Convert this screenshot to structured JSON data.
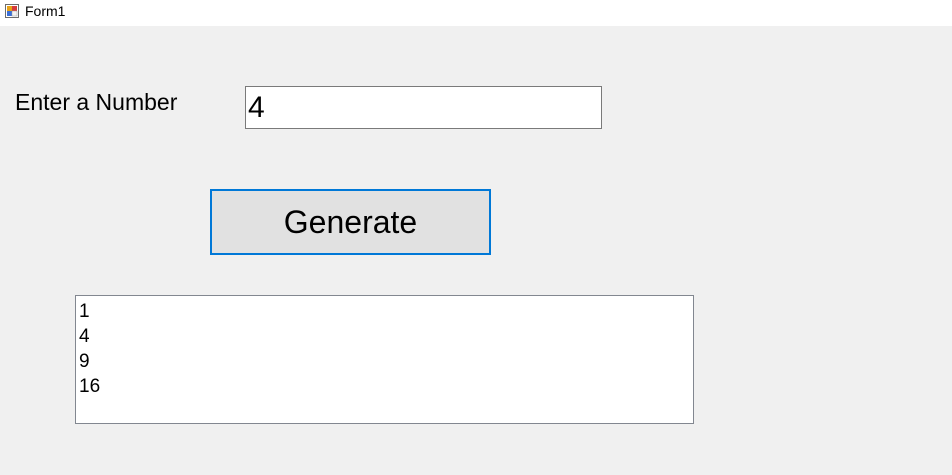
{
  "window": {
    "title": "Form1",
    "icon": "winforms-app-icon"
  },
  "form": {
    "label": "Enter a Number",
    "input_value": "4",
    "button_label": "Generate",
    "list_items": [
      "1",
      "4",
      "9",
      "16"
    ]
  },
  "colors": {
    "background": "#f0f0f0",
    "button_focus_border": "#0078d7",
    "button_face": "#e1e1e1"
  }
}
